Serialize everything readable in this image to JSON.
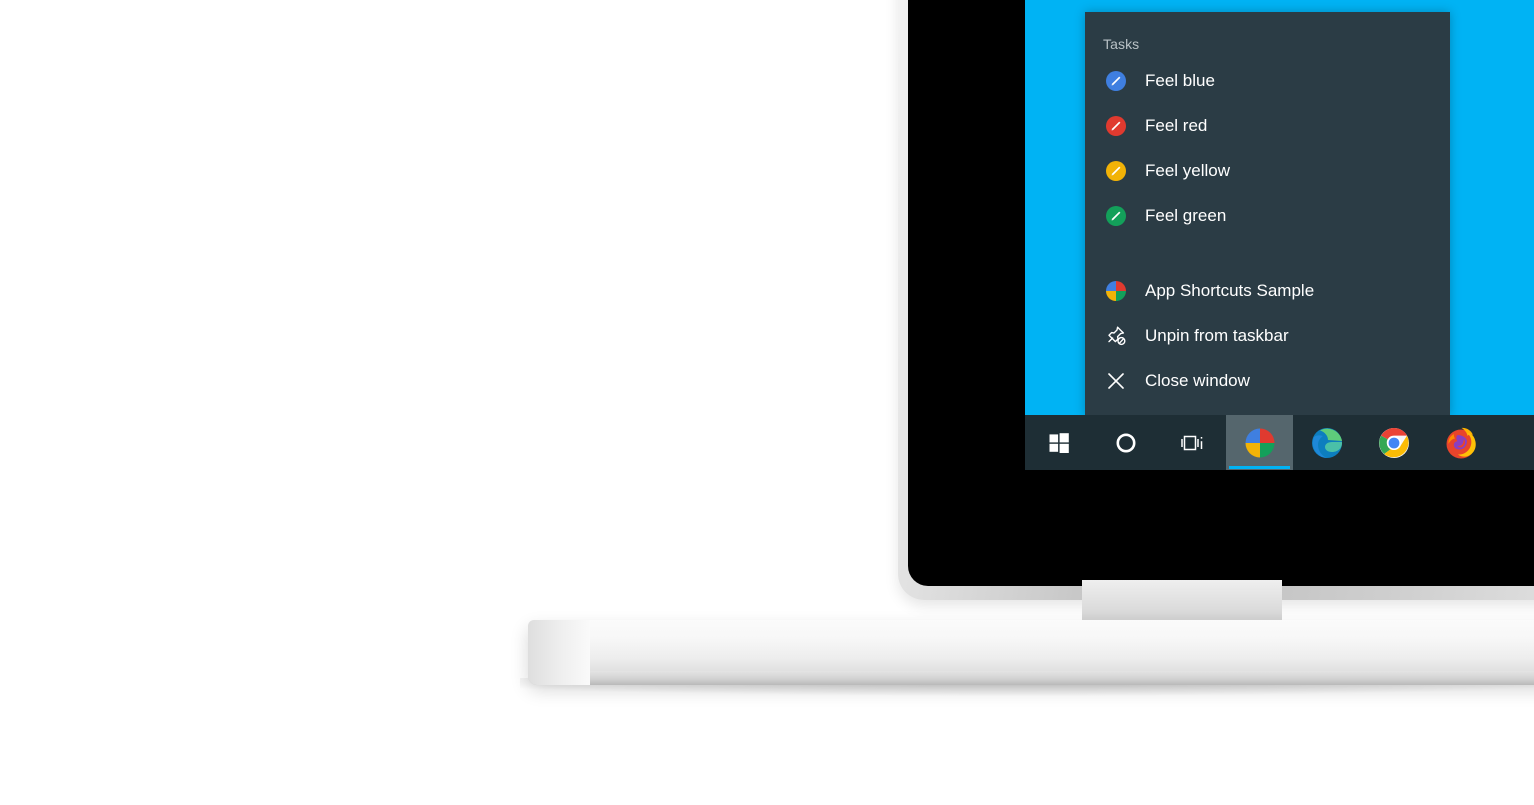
{
  "scene": {
    "device": "laptop",
    "wallpaper_color": "#00b3f4",
    "bezel_color": "#000000",
    "chassis_color": "#e8e8e8"
  },
  "jumplist": {
    "background_color": "#2b3c45",
    "header": "Tasks",
    "tasks": [
      {
        "label": "Feel blue",
        "icon": "pencil-circle-icon",
        "color": "#3f7fe0"
      },
      {
        "label": "Feel red",
        "icon": "pencil-circle-icon",
        "color": "#e03a2f"
      },
      {
        "label": "Feel yellow",
        "icon": "pencil-circle-icon",
        "color": "#f2b307"
      },
      {
        "label": "Feel green",
        "icon": "pencil-circle-icon",
        "color": "#13a05a"
      }
    ],
    "actions": [
      {
        "label": "App Shortcuts Sample",
        "icon": "app-pie-icon"
      },
      {
        "label": "Unpin from taskbar",
        "icon": "unpin-icon"
      },
      {
        "label": "Close window",
        "icon": "close-icon"
      }
    ]
  },
  "taskbar": {
    "background_color": "#1e2e35",
    "active_highlight_color": "#55666d",
    "active_underline_color": "#00b3f4",
    "items": [
      {
        "name": "start",
        "icon": "windows-start-icon",
        "label": "Start",
        "active": false
      },
      {
        "name": "cortana",
        "icon": "cortana-circle-icon",
        "label": "Cortana",
        "active": false
      },
      {
        "name": "task-view",
        "icon": "task-view-icon",
        "label": "Task View",
        "active": false
      },
      {
        "name": "app-shortcuts",
        "icon": "app-pie-icon",
        "label": "App Shortcuts Sample",
        "active": true
      },
      {
        "name": "microsoft-edge",
        "icon": "edge-icon",
        "label": "Microsoft Edge",
        "active": false
      },
      {
        "name": "google-chrome",
        "icon": "chrome-icon",
        "label": "Google Chrome",
        "active": false
      },
      {
        "name": "mozilla-firefox",
        "icon": "firefox-icon",
        "label": "Mozilla Firefox",
        "active": false
      }
    ]
  }
}
